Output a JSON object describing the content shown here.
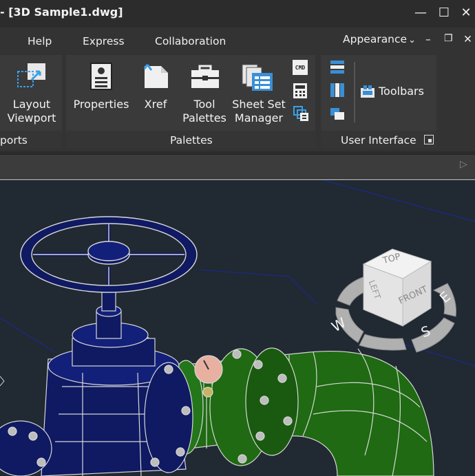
{
  "titlebar": {
    "title": "- [3D Sample1.dwg]",
    "minimize_glyph": "—",
    "maximize_glyph": "☐",
    "close_glyph": "✕"
  },
  "menubar": {
    "items": [
      "Help",
      "Express",
      "Collaboration"
    ],
    "appearance_label": "Appearance",
    "appearance_arrow": "⌄",
    "mdi_minimize": "–",
    "mdi_restore": "❐",
    "mdi_close": "✕"
  },
  "ribbon": {
    "viewports_panel": {
      "title": "ports",
      "buttons": [
        {
          "label_line1": "Layout",
          "label_line2": "Viewport",
          "icon": "layout-viewport-icon"
        }
      ]
    },
    "palettes_panel": {
      "title": "Palettes",
      "buttons": [
        {
          "label_line1": "Properties",
          "label_line2": "",
          "icon": "properties-icon"
        },
        {
          "label_line1": "Xref",
          "label_line2": "",
          "icon": "xref-icon"
        },
        {
          "label_line1": "Tool",
          "label_line2": "Palettes",
          "icon": "toolbox-icon"
        },
        {
          "label_line1": "Sheet Set",
          "label_line2": "Manager",
          "icon": "sheet-set-icon"
        }
      ],
      "small_buttons": [
        {
          "icon": "command-line-icon",
          "text": "CMD"
        },
        {
          "icon": "calculator-icon"
        },
        {
          "icon": "layers-icon"
        }
      ]
    },
    "user_interface_panel": {
      "title": "User Interface",
      "toolbars_label": "Toolbars",
      "small_buttons": [
        {
          "icon": "horizontal-tile-icon"
        },
        {
          "icon": "vertical-tile-icon"
        },
        {
          "icon": "cascade-icon"
        }
      ]
    }
  },
  "cmdstrip": {
    "arrow": "▷"
  },
  "viewcube": {
    "faces": {
      "top": "TOP",
      "front": "FRONT",
      "left": "LEFT"
    },
    "compass": {
      "west": "W",
      "south": "S",
      "east": "E"
    }
  },
  "colors": {
    "viewport_bg": "#212933",
    "ribbon_bg": "#333333",
    "panel_bg": "#3a3a3a",
    "pipe_green": "#1f6a12",
    "valve_navy": "#0f1a62"
  }
}
